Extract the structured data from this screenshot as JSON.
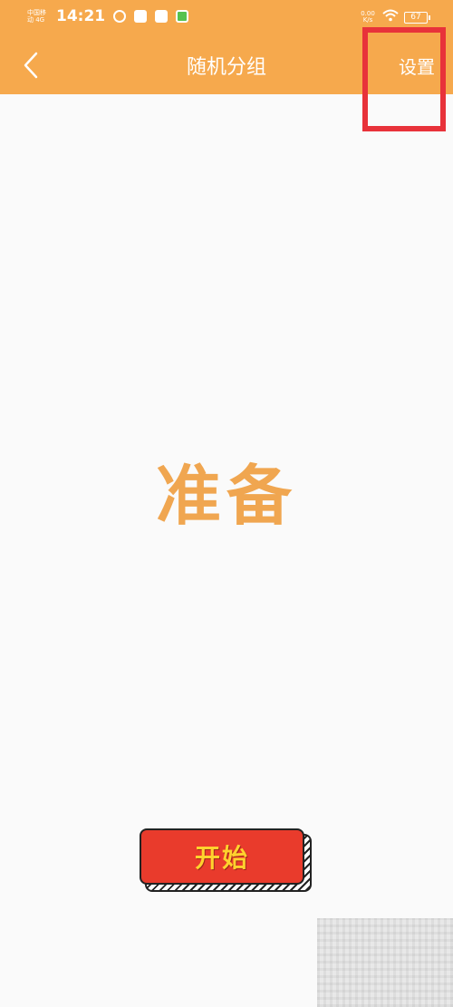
{
  "status_bar": {
    "carrier": "中国移动 4G",
    "time": "14:21",
    "net_speed": "0.00 K/s",
    "battery": "67"
  },
  "nav": {
    "title": "随机分组",
    "settings_label": "设置"
  },
  "main": {
    "status_text": "准备"
  },
  "start_button": {
    "label": "开始"
  },
  "icons": {
    "back": "chevron-left-icon",
    "wifi": "wifi-icon",
    "battery": "battery-icon"
  },
  "colors": {
    "header": "#f6a94d",
    "status_text": "#f0a650",
    "start_button": "#e93b2c",
    "start_label": "#ffd22e",
    "highlight": "#e8323a"
  }
}
